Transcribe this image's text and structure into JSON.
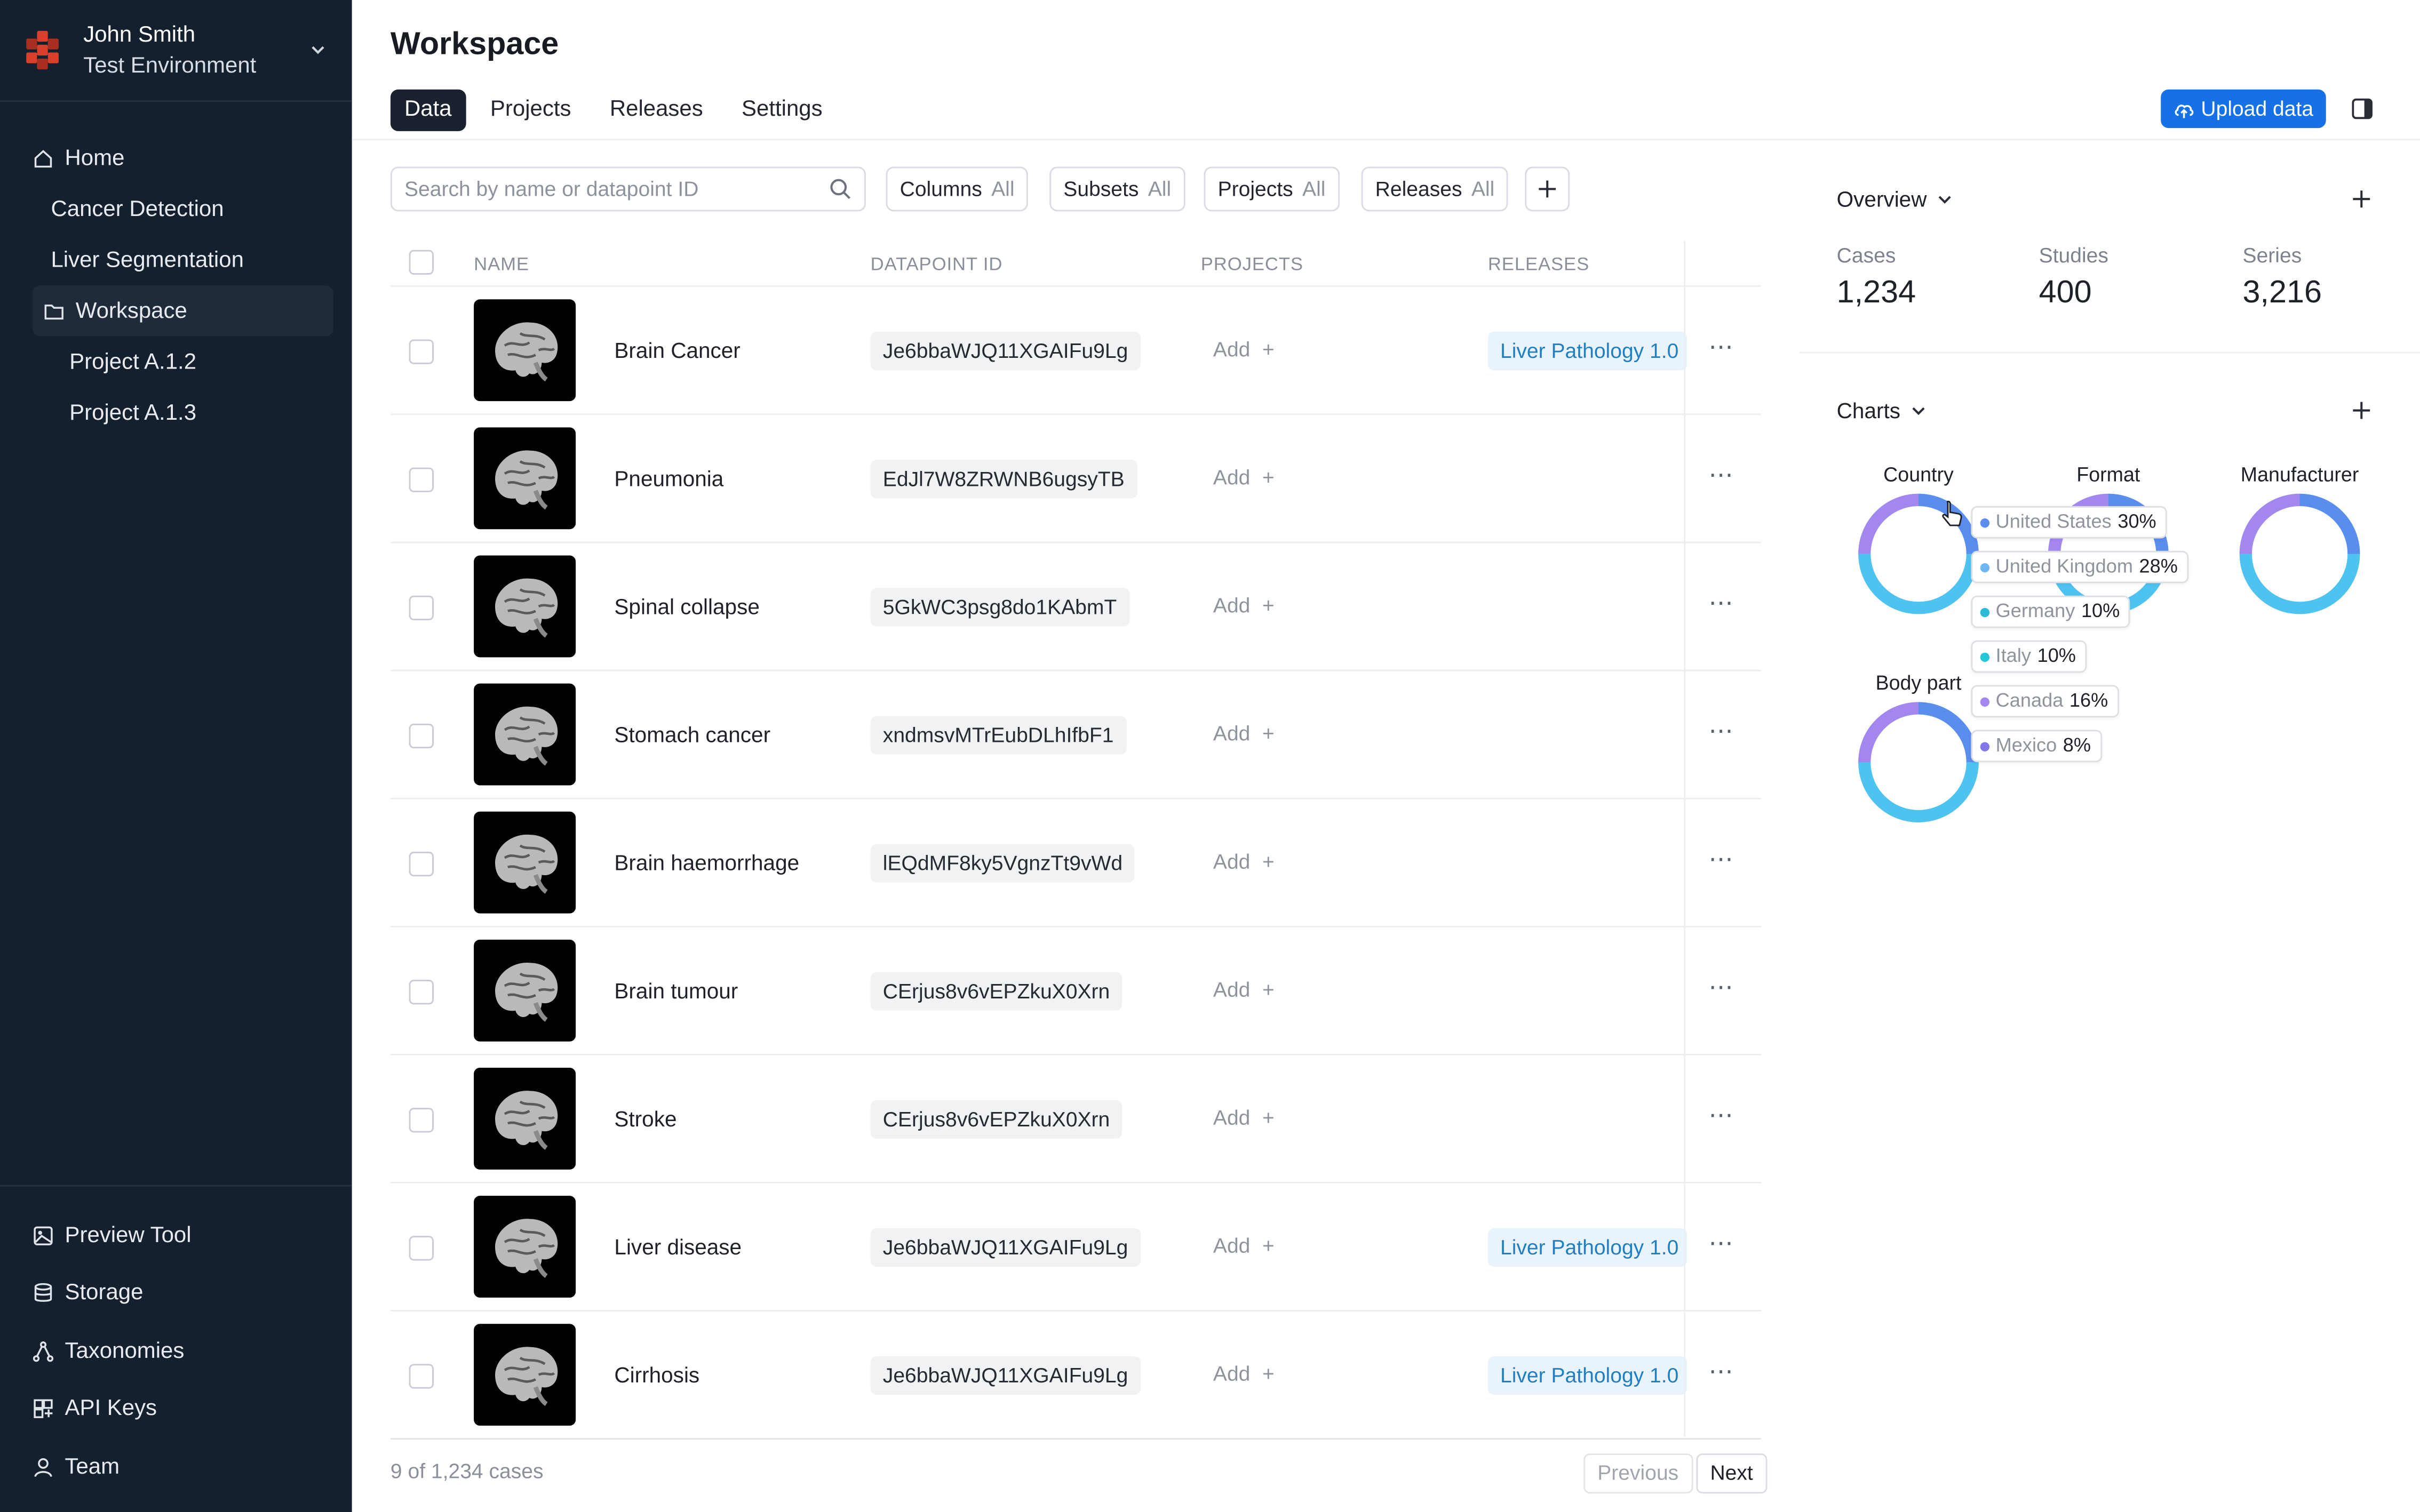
{
  "account": {
    "name": "John Smith",
    "environment": "Test Environment"
  },
  "nav": {
    "home": "Home",
    "items": [
      "Cancer Detection",
      "Liver Segmentation"
    ],
    "workspace": "Workspace",
    "sub_items": [
      "Project A.1.2",
      "Project A.1.3"
    ],
    "bottom": [
      "Preview Tool",
      "Storage",
      "Taxonomies",
      "API Keys",
      "Team"
    ]
  },
  "page": {
    "title": "Workspace"
  },
  "tabs": [
    "Data",
    "Projects",
    "Releases",
    "Settings"
  ],
  "upload_label": "Upload data",
  "search": {
    "placeholder": "Search by name or datapoint ID"
  },
  "filters": [
    {
      "label": "Columns",
      "value": "All"
    },
    {
      "label": "Subsets",
      "value": "All"
    },
    {
      "label": "Projects",
      "value": "All"
    },
    {
      "label": "Releases",
      "value": "All"
    }
  ],
  "table": {
    "headers": [
      "NAME",
      "DATAPOINT ID",
      "PROJECTS",
      "RELEASES"
    ],
    "add_label": "Add",
    "rows": [
      {
        "name": "Brain Cancer",
        "id": "Je6bbaWJQ11XGAIFu9Lg",
        "release": "Liver Pathology 1.0"
      },
      {
        "name": "Pneumonia",
        "id": "EdJl7W8ZRWNB6ugsyTB",
        "release": ""
      },
      {
        "name": "Spinal collapse",
        "id": "5GkWC3psg8do1KAbmT",
        "release": ""
      },
      {
        "name": "Stomach cancer",
        "id": "xndmsvMTrEubDLhIfbF1",
        "release": ""
      },
      {
        "name": "Brain haemorrhage",
        "id": "lEQdMF8ky5VgnzTt9vWd",
        "release": ""
      },
      {
        "name": "Brain tumour",
        "id": "CErjus8v6vEPZkuX0Xrn",
        "release": ""
      },
      {
        "name": "Stroke",
        "id": "CErjus8v6vEPZkuX0Xrn",
        "release": ""
      },
      {
        "name": "Liver disease",
        "id": "Je6bbaWJQ11XGAIFu9Lg",
        "release": "Liver Pathology 1.0"
      },
      {
        "name": "Cirrhosis",
        "id": "Je6bbaWJQ11XGAIFu9Lg",
        "release": "Liver Pathology 1.0"
      }
    ]
  },
  "footer": {
    "count": "9 of 1,234 cases",
    "previous": "Previous",
    "next": "Next"
  },
  "overview": {
    "title": "Overview",
    "stats": [
      {
        "label": "Cases",
        "value": "1,234"
      },
      {
        "label": "Studies",
        "value": "400"
      },
      {
        "label": "Series",
        "value": "3,216"
      }
    ]
  },
  "charts": {
    "title": "Charts",
    "items": [
      "Country",
      "Format",
      "Manufacturer",
      "Body part"
    ]
  },
  "tooltip": [
    {
      "label": "United States",
      "pct": "30%",
      "color": "#5b8def"
    },
    {
      "label": "United Kingdom",
      "pct": "28%",
      "color": "#6fb6f4"
    },
    {
      "label": "Germany",
      "pct": "10%",
      "color": "#2bbbd8"
    },
    {
      "label": "Italy",
      "pct": "10%",
      "color": "#26c6da"
    },
    {
      "label": "Canada",
      "pct": "16%",
      "color": "#a486ef"
    },
    {
      "label": "Mexico",
      "pct": "8%",
      "color": "#7f78e8"
    }
  ],
  "colors": {
    "sidebar": "#15202e",
    "accent": "#1771e6",
    "release_text": "#1f7fc1"
  }
}
